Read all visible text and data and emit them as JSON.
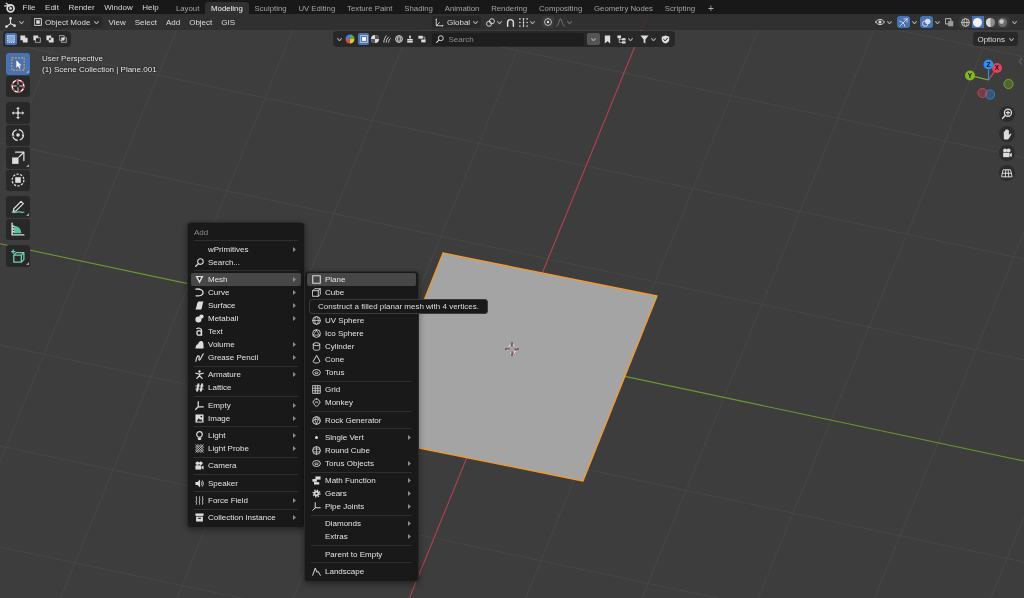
{
  "top_bar": {
    "menus": [
      "File",
      "Edit",
      "Render",
      "Window",
      "Help"
    ],
    "workspaces": [
      {
        "label": "Layout",
        "selected": false
      },
      {
        "label": "Modeling",
        "selected": true
      },
      {
        "label": "Sculpting",
        "selected": false
      },
      {
        "label": "UV Editing",
        "selected": false
      },
      {
        "label": "Texture Paint",
        "selected": false
      },
      {
        "label": "Shading",
        "selected": false
      },
      {
        "label": "Animation",
        "selected": false
      },
      {
        "label": "Rendering",
        "selected": false
      },
      {
        "label": "Compositing",
        "selected": false
      },
      {
        "label": "Geometry Nodes",
        "selected": false
      },
      {
        "label": "Scripting",
        "selected": false
      }
    ],
    "add_workspace": "+"
  },
  "header": {
    "mode": "Object Mode",
    "menus": [
      "View",
      "Select",
      "Add",
      "Object",
      "GIS"
    ],
    "orientation": "Global",
    "overlay_toggles": [
      {
        "kind": "gizmos",
        "on": true
      },
      {
        "kind": "overlays",
        "on": true
      },
      {
        "kind": "xray",
        "on": false
      }
    ],
    "shading_modes": [
      {
        "kind": "wireframe",
        "selected": false
      },
      {
        "kind": "solid",
        "selected": true
      },
      {
        "kind": "material",
        "selected": false
      },
      {
        "kind": "rendered",
        "selected": false
      }
    ]
  },
  "tool_header": {
    "select_modes": [
      {
        "kind": "set",
        "selected": true
      },
      {
        "kind": "extend",
        "selected": false
      },
      {
        "kind": "subtract",
        "selected": false
      },
      {
        "kind": "invert",
        "selected": false
      },
      {
        "kind": "intersect",
        "selected": false
      }
    ],
    "filters": [
      {
        "kind": "object",
        "selected": true
      },
      {
        "kind": "material",
        "selected": false
      },
      {
        "kind": "hair",
        "selected": false
      },
      {
        "kind": "world",
        "selected": false
      },
      {
        "kind": "brush",
        "selected": false
      },
      {
        "kind": "node",
        "selected": false
      }
    ],
    "search": {
      "placeholder": "Search"
    },
    "options": "Options"
  },
  "viewport": {
    "view_name": "User Perspective",
    "scene_info": "(1) Scene Collection | Plane.001"
  },
  "tool_groups": [
    [
      {
        "kind": "select_box",
        "selected": true
      },
      {
        "kind": "cursor",
        "selected": false
      }
    ],
    [
      {
        "kind": "move",
        "selected": false
      },
      {
        "kind": "rotate",
        "selected": false
      },
      {
        "kind": "scale",
        "selected": false
      },
      {
        "kind": "transform",
        "selected": false
      }
    ],
    [
      {
        "kind": "annotate",
        "selected": false
      },
      {
        "kind": "measure",
        "selected": false
      }
    ],
    [
      {
        "kind": "add_cube",
        "selected": false
      }
    ]
  ],
  "navigation_gizmo": {
    "axes": [
      {
        "label": "X",
        "color": "#e2445a"
      },
      {
        "label": "Y",
        "color": "#80b821"
      },
      {
        "label": "Z",
        "color": "#2f8ef0"
      }
    ]
  },
  "add_menu": {
    "title": "Add",
    "groups": [
      [
        {
          "label": "wPrimitives",
          "kind": "plain",
          "submenu": true,
          "selected": false
        },
        {
          "label": "Search...",
          "kind": "search",
          "submenu": false,
          "selected": false
        }
      ],
      [
        {
          "label": "Mesh",
          "kind": "mesh",
          "submenu": true,
          "selected": true
        },
        {
          "label": "Curve",
          "kind": "curve",
          "submenu": true,
          "selected": false
        },
        {
          "label": "Surface",
          "kind": "surface",
          "submenu": true,
          "selected": false
        },
        {
          "label": "Metaball",
          "kind": "metaball",
          "submenu": true,
          "selected": false
        },
        {
          "label": "Text",
          "kind": "text",
          "submenu": false,
          "selected": false
        },
        {
          "label": "Volume",
          "kind": "volume",
          "submenu": true,
          "selected": false
        },
        {
          "label": "Grease Pencil",
          "kind": "grease_pencil",
          "submenu": true,
          "selected": false
        }
      ],
      [
        {
          "label": "Armature",
          "kind": "armature",
          "submenu": true,
          "selected": false
        },
        {
          "label": "Lattice",
          "kind": "lattice",
          "submenu": false,
          "selected": false
        }
      ],
      [
        {
          "label": "Empty",
          "kind": "empty",
          "submenu": true,
          "selected": false
        },
        {
          "label": "Image",
          "kind": "image",
          "submenu": true,
          "selected": false
        }
      ],
      [
        {
          "label": "Light",
          "kind": "light",
          "submenu": true,
          "selected": false
        },
        {
          "label": "Light Probe",
          "kind": "light_probe",
          "submenu": true,
          "selected": false
        }
      ],
      [
        {
          "label": "Camera",
          "kind": "camera",
          "submenu": false,
          "selected": false
        }
      ],
      [
        {
          "label": "Speaker",
          "kind": "speaker",
          "submenu": false,
          "selected": false
        }
      ],
      [
        {
          "label": "Force Field",
          "kind": "force_field",
          "submenu": true,
          "selected": false
        }
      ],
      [
        {
          "label": "Collection Instance",
          "kind": "collection",
          "submenu": true,
          "selected": false
        }
      ]
    ]
  },
  "mesh_menu": {
    "groups": [
      [
        {
          "label": "Plane",
          "kind": "plane",
          "submenu": false,
          "selected": true
        },
        {
          "label": "Cube",
          "kind": "cube",
          "submenu": false,
          "selected": false
        },
        {
          "label": "UV Sphere",
          "kind": "uv_sphere",
          "submenu": false,
          "selected": false
        },
        {
          "label": "Ico Sphere",
          "kind": "ico_sphere",
          "submenu": false,
          "selected": false
        },
        {
          "label": "Cylinder",
          "kind": "cylinder",
          "submenu": false,
          "selected": false
        },
        {
          "label": "Cone",
          "kind": "cone",
          "submenu": false,
          "selected": false
        },
        {
          "label": "Torus",
          "kind": "torus",
          "submenu": false,
          "selected": false
        }
      ],
      [
        {
          "label": "Grid",
          "kind": "grid",
          "submenu": false,
          "selected": false
        },
        {
          "label": "Monkey",
          "kind": "monkey",
          "submenu": false,
          "selected": false
        }
      ],
      [
        {
          "label": "Rock Generator",
          "kind": "rock",
          "submenu": false,
          "selected": false
        }
      ],
      [
        {
          "label": "Single Vert",
          "kind": "vert",
          "submenu": true,
          "selected": false
        },
        {
          "label": "Round Cube",
          "kind": "round_cube",
          "submenu": false,
          "selected": false
        },
        {
          "label": "Torus Objects",
          "kind": "torus_objects",
          "submenu": true,
          "selected": false
        }
      ],
      [
        {
          "label": "Math Function",
          "kind": "math_function",
          "submenu": true,
          "selected": false
        },
        {
          "label": "Gears",
          "kind": "gears",
          "submenu": true,
          "selected": false
        },
        {
          "label": "Pipe Joints",
          "kind": "pipe_joints",
          "submenu": true,
          "selected": false
        }
      ],
      [
        {
          "label": "Diamonds",
          "kind": "plain",
          "submenu": true,
          "selected": false
        },
        {
          "label": "Extras",
          "kind": "plain",
          "submenu": true,
          "selected": false
        }
      ],
      [
        {
          "label": "Parent to Empty",
          "kind": "plain",
          "submenu": false,
          "selected": false
        }
      ],
      [
        {
          "label": "Landscape",
          "kind": "landscape",
          "submenu": false,
          "selected": false
        }
      ]
    ],
    "tooltip": "Construct a filled planar mesh with 4 vertices."
  }
}
